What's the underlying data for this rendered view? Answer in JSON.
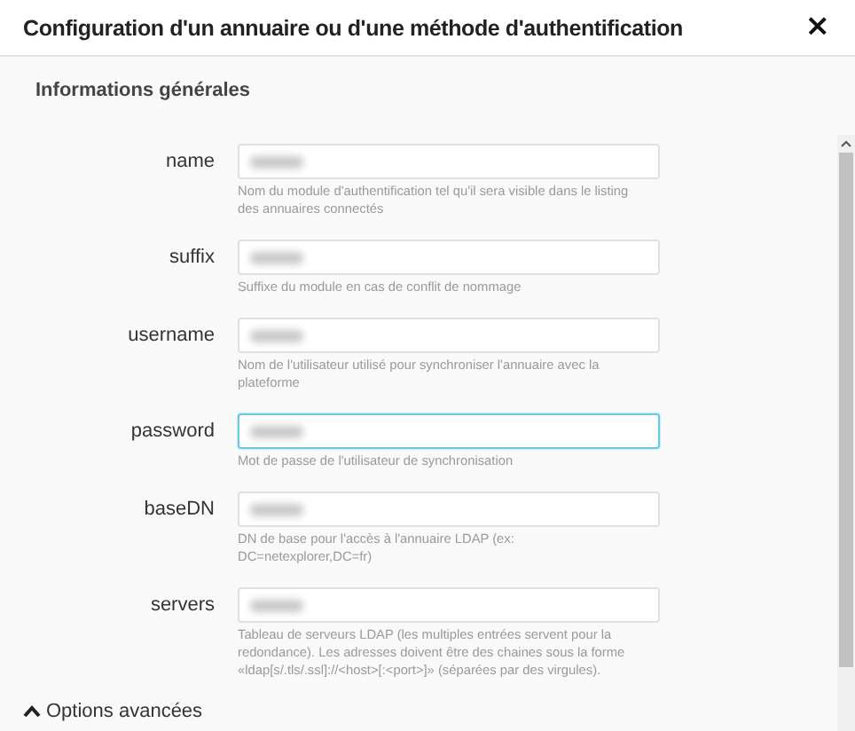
{
  "dialog": {
    "title": "Configuration d'un annuaire ou d'une méthode d'authentification",
    "close": "×"
  },
  "section": {
    "title": "Informations générales"
  },
  "fields": [
    {
      "label": "name",
      "value_blurred": true,
      "focused": false,
      "hint": "Nom du module d'authentification tel qu'il sera visible dans le listing des annuaires connectés"
    },
    {
      "label": "suffix",
      "value_blurred": true,
      "focused": false,
      "hint": "Suffixe du module en cas de conflit de nommage"
    },
    {
      "label": "username",
      "value_blurred": true,
      "focused": false,
      "hint": "Nom de l'utilisateur utilisé pour synchroniser l'annuaire avec la plateforme"
    },
    {
      "label": "password",
      "value_blurred": true,
      "focused": true,
      "hint": "Mot de passe de l'utilisateur de synchronisation"
    },
    {
      "label": "baseDN",
      "value_blurred": true,
      "focused": false,
      "hint": "DN de base pour l'accès à l'annuaire LDAP (ex: DC=netexplorer,DC=fr)"
    },
    {
      "label": "servers",
      "value_blurred": true,
      "focused": false,
      "hint": "Tableau de serveurs LDAP (les multiples entrées servent pour la redondance). Les adresses doivent être des chaines sous la forme «ldap[s/.tls/.ssl]://<host>[:<port>]» (séparées par des virgules)."
    }
  ],
  "advanced": {
    "label": "Options avancées",
    "expanded": true
  }
}
